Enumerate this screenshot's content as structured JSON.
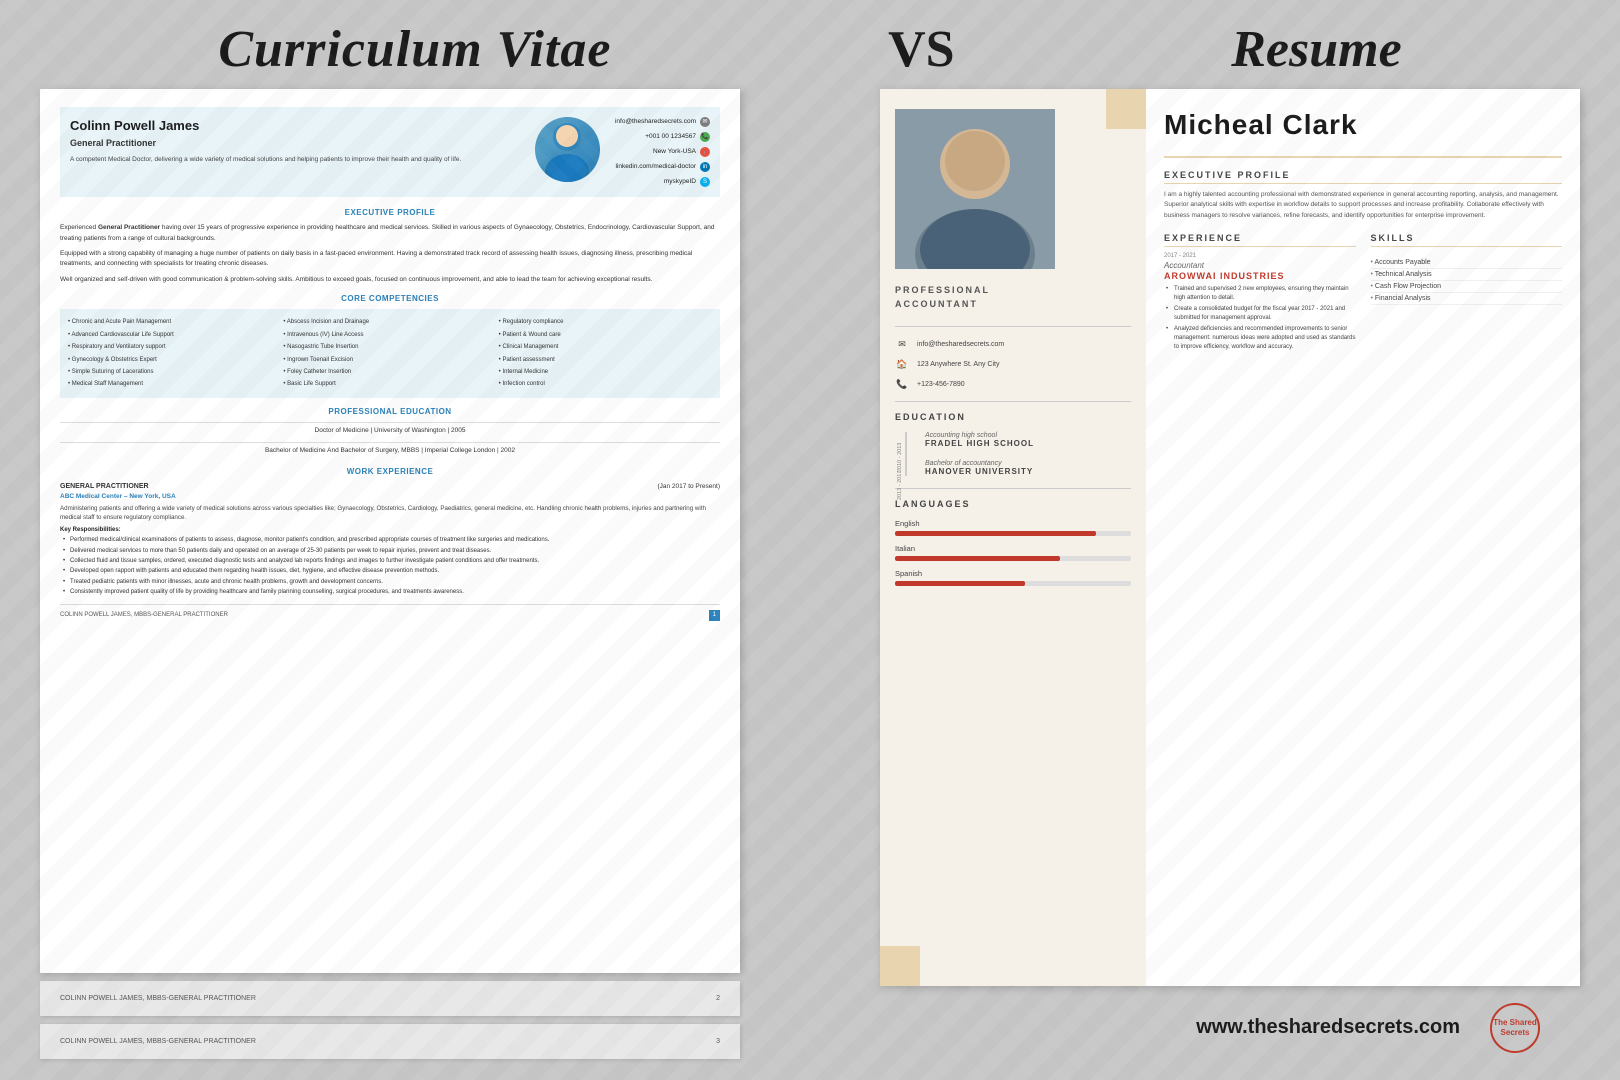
{
  "header": {
    "cv_title": "Curriculum Vitae",
    "vs_label": "VS",
    "resume_title": "Resume"
  },
  "cv": {
    "name": "Colinn Powell James",
    "title": "General Practitioner",
    "description": "A competent Medical Doctor, delivering a wide variety of medical solutions and helping patients to improve their health and quality of life.",
    "contact": {
      "email": "info@thesharedsecrets.com",
      "phone": "+001 00 1234567",
      "location": "New York-USA",
      "linkedin": "linkedin.com/medical-doctor",
      "skype": "myskypeID"
    },
    "executive_profile_title": "EXECUTIVE PROFILE",
    "executive_profile_text1": "Experienced General Practitioner having over 15 years of progressive experience in providing healthcare and medical services. Skilled in various aspects of Gynaecology, Obstetrics, Endocrinology, Cardiovascular Support, and treating patients from a range of cultural backgrounds.",
    "executive_profile_text2": "Equipped with a strong capability of managing a huge number of patients on daily basis in a fast-paced environment. Having a demonstrated track record of assessing health issues, diagnosing illness, prescribing medical treatments, and connecting with specialists for treating chronic diseases.",
    "executive_profile_text3": "Well organized and self-driven with good communication & problem-solving skills. Ambitious to exceed goals, focused on continuous improvement, and able to lead the team for achieving exceptional results.",
    "core_competencies_title": "CORE COMPETENCIES",
    "competencies": [
      "Chronic and Acute Pain Management",
      "Advanced Cardiovascular Life Support",
      "Respiratory and Ventilatory support",
      "Gynecology & Obstetrics Expert",
      "Simple Suturing of Lacerations",
      "Medical Staff Management",
      "Abscess Incision and Drainage",
      "Intravenous (IV) Line Access",
      "Nasogastric Tube Insertion",
      "Ingrown Toenail Excision",
      "Foley Catheter Insertion",
      "Basic Life Support",
      "Regulatory compliance",
      "Patient & Wound care",
      "Clinical Management",
      "Patient assessment",
      "Internal Medicine",
      "Infection control"
    ],
    "professional_education_title": "PROFESSIONAL EDUCATION",
    "education": [
      "Doctor of Medicine | University of Washington | 2005",
      "Bachelor of Medicine And Bachelor of Surgery, MBBS | Imperial College London | 2002"
    ],
    "work_experience_title": "WORK EXPERIENCE",
    "work": {
      "job_title": "GENERAL PRACTITIONER",
      "company": "ABC Medical Center – New York, USA",
      "date": "(Jan 2017 to Present)",
      "description": "Administering patients and offering a wide variety of medical solutions across various specialties like; Gynaecology, Obstetrics, Cardiology, Paediatrics, general medicine, etc. Handling chronic health problems, injuries and partnering with medical staff to ensure regulatory compliance.",
      "responsibilities_label": "Key Responsibilities:",
      "bullets": [
        "Performed medical/clinical examinations of patients to assess, diagnose, monitor patient's condition, and prescribed appropriate courses of treatment like surgeries and medications.",
        "Delivered medical services to more than 50 patients daily and operated on an average of 25-30 patients per week to repair injuries, prevent and treat diseases.",
        "Collected fluid and tissue samples, ordered, executed diagnostic tests and analyzed lab reports findings and images to further investigate patient conditions and offer treatments.",
        "Developed open rapport with patients and educated them regarding health issues, diet, hygiene, and effective disease prevention methods.",
        "Treated pediatric patients with minor illnesses, acute and chronic health problems, growth and development concerns.",
        "Consistently improved patient quality of life by providing healthcare and family planning counselling, surgical procedures, and treatments awareness."
      ]
    },
    "footer_text": "COLINN POWELL JAMES, MBBS-GENERAL PRACTITIONER",
    "page1_num": "1",
    "page2_text": "COLINN POWELL JAMES, MBBS-GENERAL PRACTITIONER",
    "page2_num": "2",
    "page3_text": "COLINN POWELL JAMES, MBBS-GENERAL PRACTITIONER",
    "page3_num": "3"
  },
  "resume": {
    "name": "Micheal Clark",
    "job_title_line1": "PROFESSIONAL",
    "job_title_line2": "ACCOUNTANT",
    "contact": {
      "email": "info@thesharedsecrets.com",
      "address": "123 Anywhere St. Any City",
      "phone": "+123-456-7890"
    },
    "executive_profile_title": "EXECUTIVE PROFILE",
    "executive_profile_text": "I am a highly talented accounting professional with demonstrated experience in general accounting reporting, analysis, and management. Superior analytical skills with expertise in workflow details to support processes and increase profitability. Collaborate effectively with business managers to resolve variances, refine forecasts, and identify opportunities for enterprise improvement.",
    "education_title": "EDUCATION",
    "education": [
      {
        "years": "2010 - 2013",
        "degree": "Accounting high school",
        "school": "FRADEL HIGH SCHOOL"
      },
      {
        "years": "2013 - 2017",
        "degree": "Bachelor of accountancy",
        "school": "HANOVER UNIVERSITY"
      }
    ],
    "languages_title": "LANGUAGES",
    "languages": [
      {
        "name": "English",
        "percent": 85
      },
      {
        "name": "Italian",
        "percent": 70
      },
      {
        "name": "Spanish",
        "percent": 55
      }
    ],
    "experience_title": "EXPERIENCE",
    "experience": {
      "years": "2017 - 2021",
      "title": "Accountant",
      "company": "AROWWAI INDUSTRIES",
      "bullets": [
        "Trained and supervised 2 new employees, ensuring they maintain high attention to detail.",
        "Create a consolidated budget for the fiscal year 2017 - 2021 and submitted for management approval.",
        "Analyzed deficiencies and recommended improvements to senior management: numerous ideas were adopted and used as standards to improve efficiency, workflow and accuracy."
      ]
    },
    "skills_title": "SKILLS",
    "skills": [
      "Accounts Payable",
      "Technical Analysis",
      "Cash Flow Projection",
      "Financial Analysis"
    ]
  },
  "footer": {
    "website": "www.thesharedsecrets.com",
    "logo_line1": "The Shared",
    "logo_line2": "Secrets"
  }
}
